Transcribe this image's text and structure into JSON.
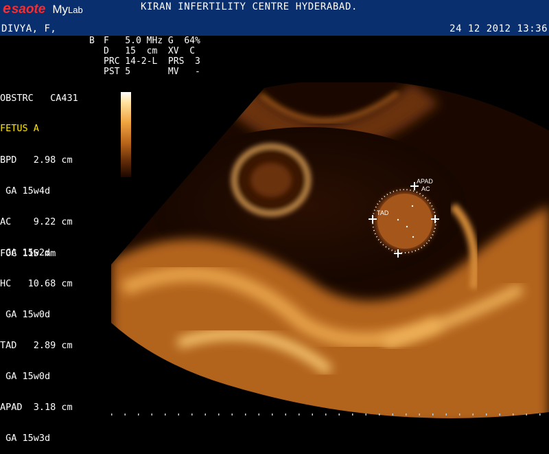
{
  "header": {
    "brand_mark": "e",
    "brand_name": "saote",
    "product": "My",
    "product_suffix": "Lab",
    "centre": "KIRAN INFERTILITY CENTRE HYDERABAD.",
    "patient": "DIVYA, F,",
    "datetime": "24 12 2012 13:36"
  },
  "acquisition": {
    "mode": "B",
    "lines": [
      "F   5.0 MHz G  64%",
      "D   15  cm  XV  C",
      "PRC 14-2-L  PRS  3",
      "PST 5       MV   -"
    ]
  },
  "preset": "OBSTRC   CA431",
  "fetus_label": "FETUS A",
  "measurements": [
    {
      "name": "BPD",
      "value": "2.98 cm",
      "ga": "GA 15w4d"
    },
    {
      "name": "AC",
      "value": "9.22 cm",
      "ga": "GA 15w2d"
    },
    {
      "name": "HC",
      "value": "10.68 cm",
      "ga": "GA 15w0d"
    },
    {
      "name": "TAD",
      "value": "2.89 cm",
      "ga": "GA 15w0d"
    },
    {
      "name": "APAD",
      "value": "3.18 cm",
      "ga": "GA 15w3d"
    }
  ],
  "measurement_lines": [
    "BPD   2.98 cm",
    " GA 15w4d",
    "AC    9.22 cm",
    " GA 15w2d",
    "HC   10.68 cm",
    " GA 15w0d",
    "TAD   2.89 cm",
    " GA 15w0d",
    "APAD  3.18 cm",
    " GA 15w3d"
  ],
  "focus": "FOC 115 mm",
  "caliper_labels": {
    "apad": "APAD",
    "ac": "AC",
    "tad": "TAD"
  },
  "colors": {
    "header_bg": "#0a2f6e",
    "brand_red": "#ff2a2a",
    "fetus_label": "#ffe600"
  }
}
